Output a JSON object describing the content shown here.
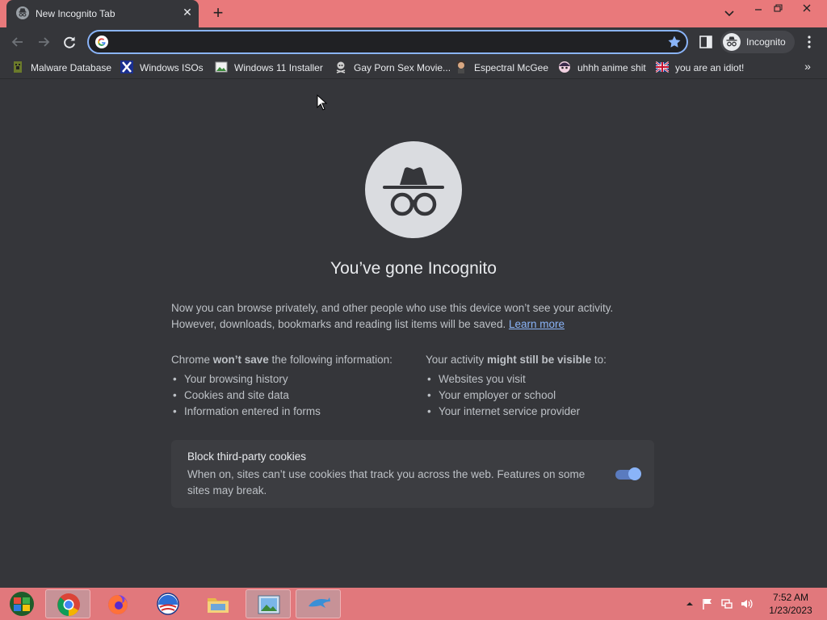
{
  "window": {
    "tab_title": "New Incognito Tab",
    "tab_close": "✕",
    "new_tab": "+"
  },
  "toolbar": {
    "address_value": "",
    "profile_label": "Incognito"
  },
  "bookmarks": {
    "items": [
      {
        "label": "Malware Database"
      },
      {
        "label": "Windows ISOs"
      },
      {
        "label": "Windows 11 Installer"
      },
      {
        "label": "Gay Porn Sex Movie..."
      },
      {
        "label": "Espectral McGee"
      },
      {
        "label": "uhhh anime shit"
      },
      {
        "label": "you are an idiot!"
      }
    ],
    "overflow": "»"
  },
  "page": {
    "headline": "You’ve gone Incognito",
    "intro": "Now you can browse privately, and other people who use this device won’t see your activity. However, downloads, bookmarks and reading list items will be saved.",
    "learn_more": "Learn more",
    "left_heading_pre": "Chrome ",
    "left_heading_bold": "won’t save",
    "left_heading_post": " the following information:",
    "left_items": [
      "Your browsing history",
      "Cookies and site data",
      "Information entered in forms"
    ],
    "right_heading_pre": "Your activity ",
    "right_heading_bold": "might still be visible",
    "right_heading_post": " to:",
    "right_items": [
      "Websites you visit",
      "Your employer or school",
      "Your internet service provider"
    ],
    "cookie_title": "Block third-party cookies",
    "cookie_desc": "When on, sites can’t use cookies that track you across the web. Features on some sites may break.",
    "cookie_toggle_on": true
  },
  "taskbar": {
    "time": "7:52 AM",
    "date": "1/23/2023"
  },
  "colors": {
    "accent": "#8ab4f8",
    "frame": "#e9797b",
    "background": "#35363a"
  }
}
